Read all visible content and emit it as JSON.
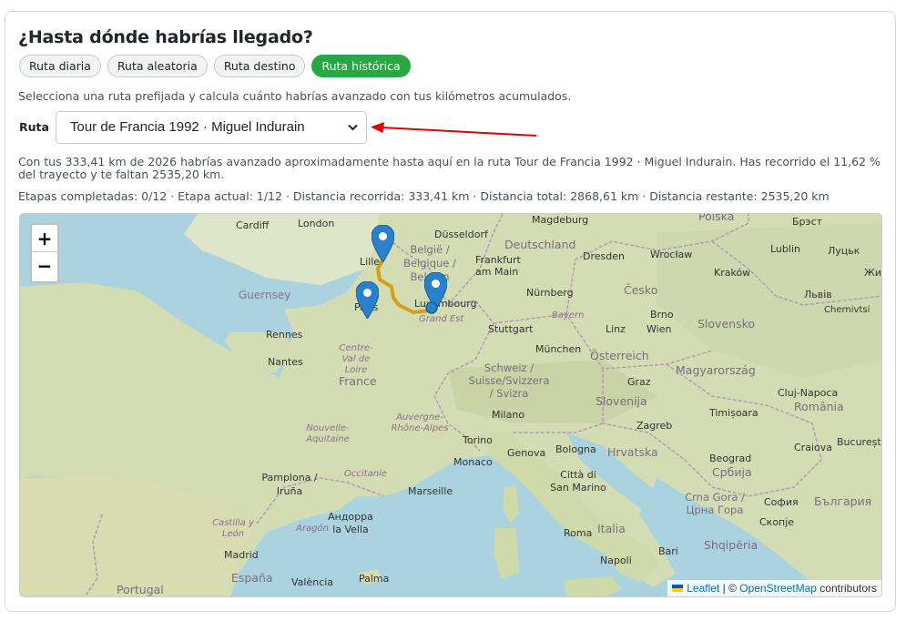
{
  "title": "¿Hasta dónde habrías llegado?",
  "tabs": [
    {
      "label": "Ruta diaria",
      "active": false
    },
    {
      "label": "Ruta aleatoria",
      "active": false
    },
    {
      "label": "Ruta destino",
      "active": false
    },
    {
      "label": "Ruta histórica",
      "active": true
    }
  ],
  "description": "Selecciona una ruta prefijada y calcula cuánto habrías avanzado con tus kilómetros acumulados.",
  "route": {
    "label": "Ruta",
    "selected": "Tour de Francia 1992 · Miguel Indurain"
  },
  "summary": "Con tus 333,41 km de 2026 habrías avanzado aproximadamente hasta aquí en la ruta Tour de Francia 1992 · Miguel Indurain. Has recorrido el 11,62 % del trayecto y te faltan 2535,20 km.",
  "stats": "Etapas completadas: 0/12 · Etapa actual: 1/12 · Distancia recorrida: 333,41 km · Distancia total: 2868,61 km · Distancia restante: 2535,20 km",
  "map": {
    "zoom_in": "+",
    "zoom_out": "−",
    "attribution": {
      "leaflet": "Leaflet",
      "separator": " | © ",
      "osm": "OpenStreetMap",
      "suffix": " contributors"
    },
    "labels": {
      "cities": [
        "Cardiff",
        "London",
        "Lille",
        "Düsseldorf",
        "Magdeburg",
        "Polska",
        "Брэст",
        "Frankfurt am Main",
        "Dresden",
        "Wrocław",
        "Lublin",
        "Луцьк",
        "Жит",
        "Kraków",
        "Львів",
        "Luxembourg",
        "Paris",
        "Nürnberg",
        "Česko",
        "Rennes",
        "Stuttgart",
        "Brno",
        "Linz",
        "Wien",
        "Slovensko",
        "München",
        "Nantes",
        "Schweiz / Suisse/Svizzera / Svizra",
        "Graz",
        "Magyarország",
        "Cluj-Napoca",
        "Slovenija",
        "Milano",
        "Timișoara",
        "Torino",
        "Genova",
        "Bologna",
        "Zagreb",
        "Hrvatska",
        "Craiova",
        "București",
        "Pamplona / Iruña",
        "Monaco",
        "Marseille",
        "Città di San Marino",
        "Beograd",
        "Србија",
        "Crna Gora / Црна Гора",
        "София",
        "България",
        "Андорра la Vella",
        "Roma",
        "Скопје",
        "Madrid",
        "Bari",
        "Shqipëria",
        "Napoli",
        "Palma",
        "València",
        "Portugal",
        "Chernivtsi"
      ],
      "countries": [
        "Deutschland",
        "België / Belgique / Belgien",
        "France",
        "Österreich",
        "Italia",
        "España",
        "România"
      ],
      "regions": [
        "Guernsey",
        "Grand Est",
        "Centre-Val de Loire",
        "Bayern",
        "Nouvelle-Aquitaine",
        "Auvergne-Rhône-Alpes",
        "Occitanie",
        "Castilla y León",
        "Aragón"
      ]
    },
    "route_color": "#d4a017",
    "marker_color": "#2a81cb"
  }
}
